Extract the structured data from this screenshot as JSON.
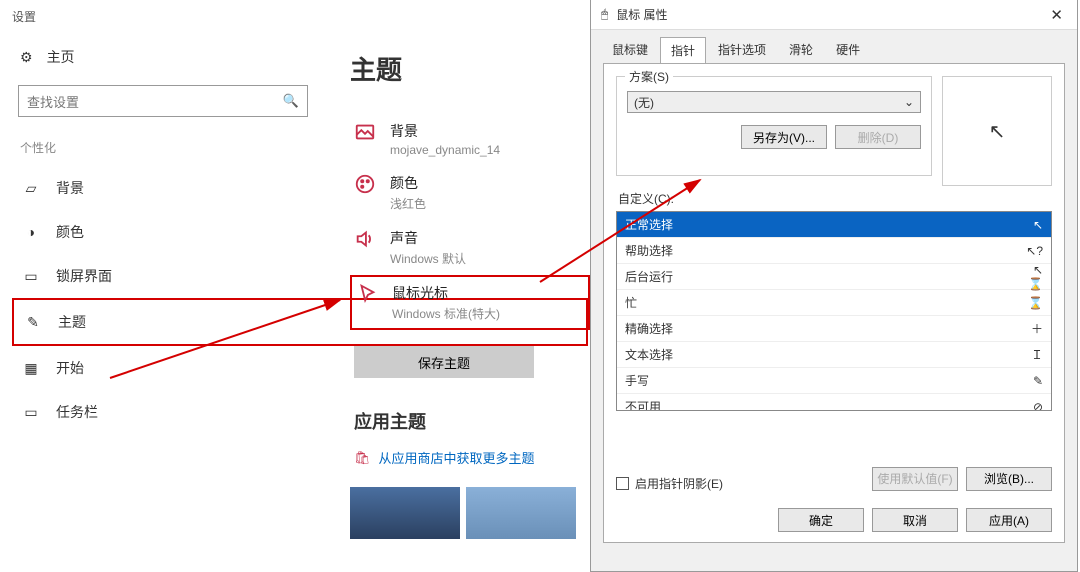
{
  "settings": {
    "windowTitle": "设置",
    "home": "主页",
    "searchPlaceholder": "查找设置",
    "section": "个性化",
    "nav": [
      {
        "label": "背景"
      },
      {
        "label": "颜色"
      },
      {
        "label": "锁屏界面"
      },
      {
        "label": "主题"
      },
      {
        "label": "开始"
      },
      {
        "label": "任务栏"
      }
    ],
    "pageHeading": "主题",
    "options": [
      {
        "title": "背景",
        "sub": "mojave_dynamic_14"
      },
      {
        "title": "颜色",
        "sub": "浅红色"
      },
      {
        "title": "声音",
        "sub": "Windows 默认"
      },
      {
        "title": "鼠标光标",
        "sub": "Windows 标准(特大)"
      }
    ],
    "saveBtn": "保存主题",
    "applyHeading": "应用主题",
    "storeLink": "从应用商店中获取更多主题"
  },
  "dlg": {
    "title": "鼠标 属性",
    "tabs": [
      "鼠标键",
      "指针",
      "指针选项",
      "滑轮",
      "硬件"
    ],
    "schemeLabel": "方案(S)",
    "schemeValue": "(无)",
    "saveAs": "另存为(V)...",
    "delete": "删除(D)",
    "customLabel": "自定义(C):",
    "cursors": [
      {
        "name": "正常选择",
        "glyph": "↖"
      },
      {
        "name": "帮助选择",
        "glyph": "↖?"
      },
      {
        "name": "后台运行",
        "glyph": "↖⌛"
      },
      {
        "name": "忙",
        "glyph": "⌛"
      },
      {
        "name": "精确选择",
        "glyph": "＋"
      },
      {
        "name": "文本选择",
        "glyph": "Ｉ"
      },
      {
        "name": "手写",
        "glyph": "✎"
      },
      {
        "name": "不可用",
        "glyph": "⊘"
      }
    ],
    "shadow": "启用指针阴影(E)",
    "useDefault": "使用默认值(F)",
    "browse": "浏览(B)...",
    "ok": "确定",
    "cancel": "取消",
    "apply": "应用(A)"
  }
}
